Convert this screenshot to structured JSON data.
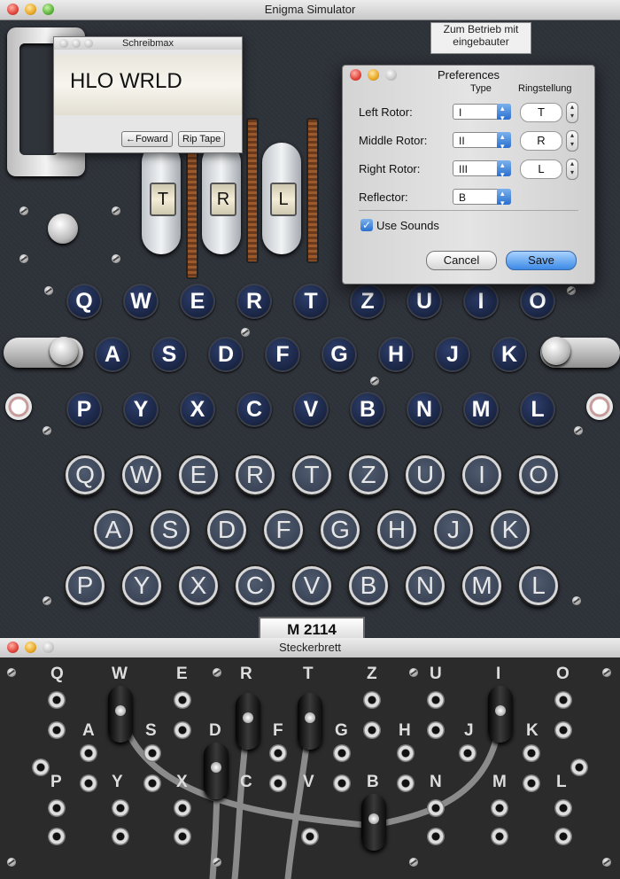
{
  "main_window": {
    "title": "Enigma Simulator"
  },
  "notch_label": "Zum Betrieb mit eingebauter",
  "schreibmax": {
    "title": "Schreibmax",
    "tape_text": "HLO WRLD",
    "forward_label": "←Foward",
    "rip_label": "Rip Tape"
  },
  "rotor_windows": [
    "T",
    "R",
    "L"
  ],
  "lampboard_rows": [
    [
      "Q",
      "W",
      "E",
      "R",
      "T",
      "Z",
      "U",
      "I",
      "O"
    ],
    [
      "A",
      "S",
      "D",
      "F",
      "G",
      "H",
      "J",
      "K"
    ],
    [
      "P",
      "Y",
      "X",
      "C",
      "V",
      "B",
      "N",
      "M",
      "L"
    ]
  ],
  "keyboard_rows": [
    [
      "Q",
      "W",
      "E",
      "R",
      "T",
      "Z",
      "U",
      "I",
      "O"
    ],
    [
      "A",
      "S",
      "D",
      "F",
      "G",
      "H",
      "J",
      "K"
    ],
    [
      "P",
      "Y",
      "X",
      "C",
      "V",
      "B",
      "N",
      "M",
      "L"
    ]
  ],
  "serial_plate": "M 2114",
  "preferences": {
    "title": "Preferences",
    "type_header": "Type",
    "ring_header": "Ringstellung",
    "left_label": "Left Rotor:",
    "left_type": "I",
    "left_ring": "T",
    "middle_label": "Middle Rotor:",
    "middle_type": "II",
    "middle_ring": "R",
    "right_label": "Right Rotor:",
    "right_type": "III",
    "right_ring": "L",
    "reflector_label": "Reflector:",
    "reflector_value": "B",
    "use_sounds_label": "Use Sounds",
    "use_sounds_checked": true,
    "cancel_label": "Cancel",
    "save_label": "Save"
  },
  "steckerbrett": {
    "title": "Steckerbrett",
    "rows": [
      [
        "Q",
        "W",
        "E",
        "R",
        "T",
        "Z",
        "U",
        "I",
        "O"
      ],
      [
        "A",
        "S",
        "D",
        "F",
        "G",
        "H",
        "J",
        "K"
      ],
      [
        "P",
        "Y",
        "X",
        "C",
        "V",
        "B",
        "N",
        "M",
        "L"
      ]
    ],
    "plugged": [
      "W",
      "R",
      "T",
      "I",
      "D",
      "B"
    ]
  }
}
